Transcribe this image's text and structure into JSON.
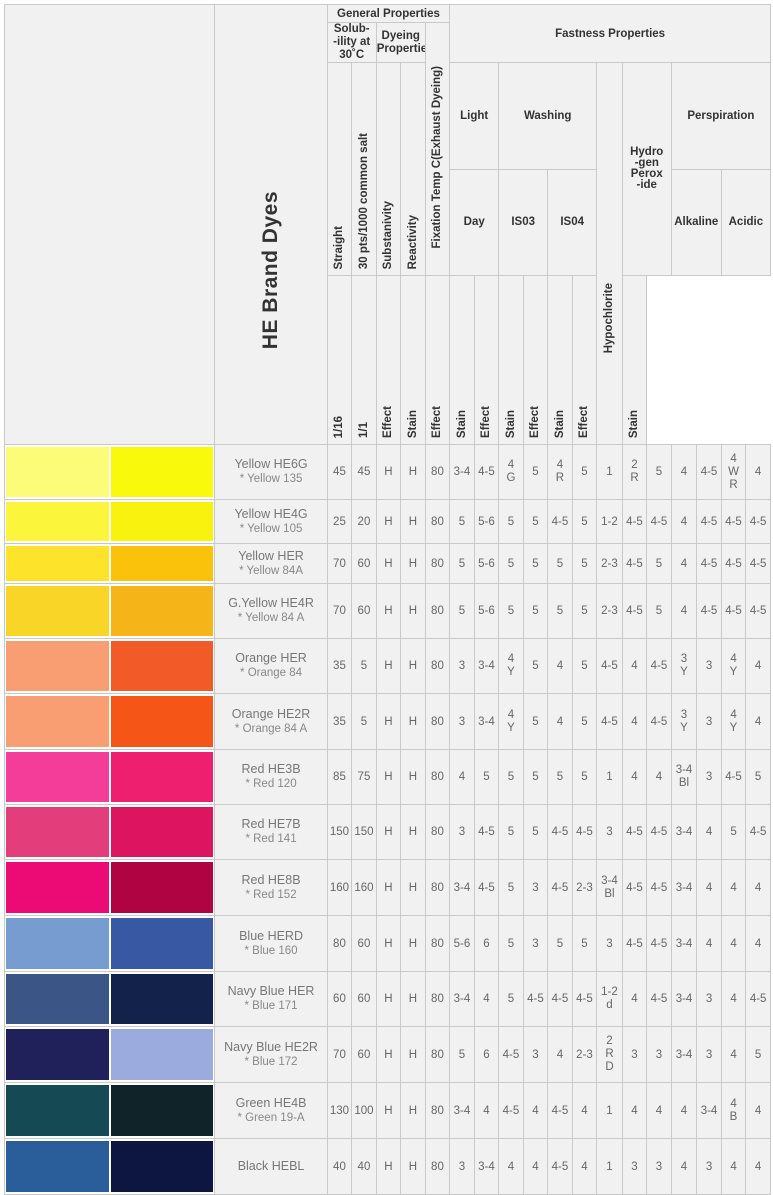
{
  "header": {
    "brand_title": "HE Brand Dyes",
    "general_properties": "General Properties",
    "solubility": [
      "Solub-",
      "-ility at",
      "30˚C"
    ],
    "dyeing_properties": [
      "Dyeing",
      "Properties"
    ],
    "fastness_properties": "Fastness Properties",
    "light": "Light",
    "day": "Day",
    "washing": "Washing",
    "iso3": "IS03",
    "iso4": "IS04",
    "hydrogen_peroxide": [
      "Hydro",
      "-gen",
      "Perox",
      "-ide"
    ],
    "perspiration": "Perspiration",
    "alkaline": "Alkaline",
    "acidic": "Acidic",
    "columns": [
      "Straight",
      "30 pts/1000 common salt",
      "Substanivity",
      "Reactivity",
      "Fixation Temp C(Exhaust Dyeing)",
      "1/16",
      "1/1",
      "Effect",
      "Stain",
      "Effect",
      "Stain",
      "Hypochlorite",
      "Effect",
      "Stain",
      "Effect",
      "Stain",
      "Effect",
      "Stain"
    ]
  },
  "rows": [
    {
      "name": "Yellow HE6G",
      "sub": "* Yellow 135",
      "colors": [
        "#fcfc78",
        "#f9f90c"
      ],
      "values": [
        "45",
        "45",
        "H",
        "H",
        "80",
        "3-4",
        "4-5",
        [
          "4",
          "G"
        ],
        "5",
        [
          "4",
          "R"
        ],
        "5",
        "1",
        [
          "2",
          "R"
        ],
        "5",
        "4",
        "4-5",
        [
          "4",
          "W",
          "R"
        ],
        "4"
      ]
    },
    {
      "name": "Yellow HE4G",
      "sub": "* Yellow 105",
      "colors": [
        "#fbf63c",
        "#f9f20e"
      ],
      "values": [
        "25",
        "20",
        "H",
        "H",
        "80",
        "5",
        "5-6",
        "5",
        "5",
        "4-5",
        "5",
        "1-2",
        "4-5",
        "4-5",
        "4",
        "4-5",
        "4-5",
        "4-5"
      ]
    },
    {
      "name": "Yellow HER",
      "sub": "* Yellow 84A",
      "colors": [
        "#fde32a",
        "#fbc20c"
      ],
      "values": [
        "70",
        "60",
        "H",
        "H",
        "80",
        "5",
        "5-6",
        "5",
        "5",
        "5",
        "5",
        "2-3",
        "4-5",
        "5",
        "4",
        "4-5",
        "4-5",
        "4-5"
      ]
    },
    {
      "name": "G.Yellow HE4R",
      "sub": "* Yellow 84 A",
      "colors": [
        "#f9d528",
        "#f5b519"
      ],
      "values": [
        "70",
        "60",
        "H",
        "H",
        "80",
        "5",
        "5-6",
        "5",
        "5",
        "5",
        "5",
        "2-3",
        "4-5",
        "5",
        "4",
        "4-5",
        "4-5",
        "4-5"
      ]
    },
    {
      "name": "Orange HER",
      "sub": "* Orange 84",
      "colors": [
        "#f99d73",
        "#f25b28"
      ],
      "values": [
        "35",
        "5",
        "H",
        "H",
        "80",
        "3",
        "3-4",
        [
          "4",
          "Y"
        ],
        "5",
        "4",
        "5",
        "4-5",
        "4",
        "4-5",
        [
          "3",
          "Y"
        ],
        "3",
        [
          "4",
          "Y"
        ],
        "4"
      ]
    },
    {
      "name": "Orange HE2R",
      "sub": "* Orange 84 A",
      "colors": [
        "#f99d73",
        "#f55516"
      ],
      "values": [
        "35",
        "5",
        "H",
        "H",
        "80",
        "3",
        "3-4",
        [
          "4",
          "Y"
        ],
        "5",
        "4",
        "5",
        "4-5",
        "4",
        "4-5",
        [
          "3",
          "Y"
        ],
        "3",
        [
          "4",
          "Y"
        ],
        "4"
      ]
    },
    {
      "name": "Red HE3B",
      "sub": "* Red 120",
      "colors": [
        "#f43d98",
        "#ee1f6e"
      ],
      "values": [
        "85",
        "75",
        "H",
        "H",
        "80",
        "4",
        "5",
        "5",
        "5",
        "5",
        "5",
        "1",
        "4",
        "4",
        [
          "3-4",
          "Bl"
        ],
        "3",
        "4-5",
        "5"
      ]
    },
    {
      "name": "Red HE7B",
      "sub": "* Red 141",
      "colors": [
        "#e43d7c",
        "#dd1460"
      ],
      "values": [
        "150",
        "150",
        "H",
        "H",
        "80",
        "3",
        "4-5",
        "5",
        "5",
        "4-5",
        "4-5",
        "3",
        "4-5",
        "4-5",
        "3-4",
        "4",
        "5",
        "4-5"
      ]
    },
    {
      "name": "Red HE8B",
      "sub": "* Red 152",
      "colors": [
        "#ec0a74",
        "#b00342"
      ],
      "values": [
        "160",
        "160",
        "H",
        "H",
        "80",
        "3-4",
        "4-5",
        "5",
        "3",
        "4-5",
        "2-3",
        [
          "3-4",
          "Bl"
        ],
        "4-5",
        "4-5",
        "3-4",
        "4",
        "4",
        "4"
      ]
    },
    {
      "name": "Blue HERD",
      "sub": "* Blue 160",
      "colors": [
        "#779ccf",
        "#3958a4"
      ],
      "values": [
        "80",
        "60",
        "H",
        "H",
        "80",
        "5-6",
        "6",
        "5",
        "3",
        "5",
        "5",
        "3",
        "4-5",
        "4-5",
        "3-4",
        "4",
        "4",
        "4"
      ]
    },
    {
      "name": "Navy Blue HER",
      "sub": "* Blue 171",
      "colors": [
        "#3c5587",
        "#13224b"
      ],
      "values": [
        "60",
        "60",
        "H",
        "H",
        "80",
        "3-4",
        "4",
        "5",
        "4-5",
        "4-5",
        "4-5",
        [
          "1-2",
          "d"
        ],
        "4",
        "4-5",
        "3-4",
        "3",
        "4",
        "4-5"
      ]
    },
    {
      "name": "Navy Blue HE2R",
      "sub": "* Blue 172",
      "colors": [
        "#20205a",
        "#9babdd"
      ],
      "values": [
        "70",
        "60",
        "H",
        "H",
        "80",
        "5",
        "6",
        "4-5",
        "3",
        "4",
        "2-3",
        [
          "2",
          "R",
          "D"
        ],
        "3",
        "3",
        "3-4",
        "3",
        "4",
        "5"
      ]
    },
    {
      "name": "Green HE4B",
      "sub": "* Green 19-A",
      "colors": [
        "#154a54",
        "#0f2329"
      ],
      "values": [
        "130",
        "100",
        "H",
        "H",
        "80",
        "3-4",
        "4",
        "4-5",
        "4",
        "4-5",
        "4",
        "1",
        "4",
        "4",
        "4",
        "3-4",
        [
          "4",
          "B"
        ],
        "4"
      ]
    },
    {
      "name": "Black HEBL",
      "sub": "",
      "colors": [
        "#2a5e9a",
        "#0d1640"
      ],
      "values": [
        "40",
        "40",
        "H",
        "H",
        "80",
        "3",
        "3-4",
        "4",
        "4",
        "4-5",
        "4",
        "1",
        "3",
        "3",
        "4",
        "3",
        "4",
        "4"
      ]
    }
  ]
}
